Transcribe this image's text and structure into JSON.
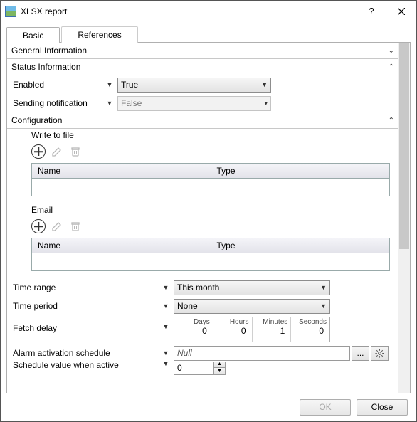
{
  "window": {
    "title": "XLSX report"
  },
  "tabs": {
    "basic": "Basic",
    "references": "References",
    "active": "basic"
  },
  "groups": {
    "general": {
      "label": "General Information",
      "expanded": false
    },
    "status": {
      "label": "Status Information",
      "expanded": true
    },
    "config": {
      "label": "Configuration",
      "expanded": true
    }
  },
  "status": {
    "enabled": {
      "label": "Enabled",
      "value": "True"
    },
    "sending_notification": {
      "label": "Sending notification",
      "value": "False",
      "disabled": true
    }
  },
  "config": {
    "write_to_file": {
      "label": "Write to file",
      "cols": {
        "name": "Name",
        "type": "Type"
      }
    },
    "email": {
      "label": "Email",
      "cols": {
        "name": "Name",
        "type": "Type"
      }
    },
    "time_range": {
      "label": "Time range",
      "value": "This month"
    },
    "time_period": {
      "label": "Time period",
      "value": "None"
    },
    "fetch_delay": {
      "label": "Fetch delay",
      "units": {
        "days": "Days",
        "hours": "Hours",
        "minutes": "Minutes",
        "seconds": "Seconds"
      },
      "values": {
        "days": "0",
        "hours": "0",
        "minutes": "1",
        "seconds": "0"
      }
    },
    "alarm_schedule": {
      "label": "Alarm activation schedule",
      "value": "Null"
    },
    "schedule_value_cut": {
      "label": "Schedule value when active",
      "value": "0"
    }
  },
  "footer": {
    "ok": "OK",
    "close": "Close"
  }
}
